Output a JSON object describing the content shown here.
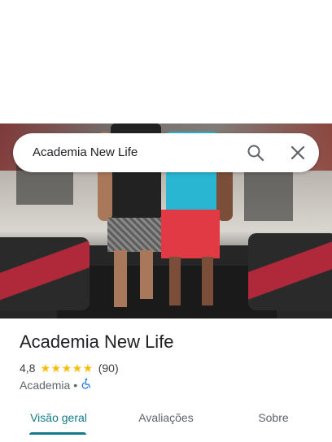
{
  "search": {
    "query": "Academia New Life"
  },
  "place": {
    "name": "Academia New Life",
    "rating": "4,8",
    "stars": "★★★★★",
    "review_count": "(90)",
    "category": "Academia",
    "separator": "•",
    "accessibility_icon": "wheelchair-icon"
  },
  "tabs": [
    {
      "label": "Visão geral",
      "active": true
    },
    {
      "label": "Avaliações",
      "active": false
    },
    {
      "label": "Sobre",
      "active": false
    }
  ],
  "colors": {
    "accent": "#137b86",
    "star": "#fbbc04",
    "accessibility": "#1a73e8"
  }
}
